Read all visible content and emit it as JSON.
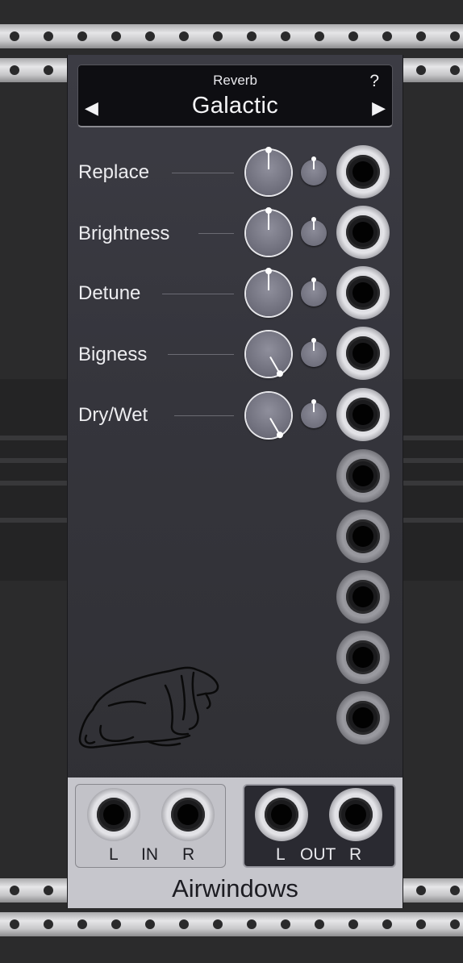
{
  "module": {
    "category": "Reverb",
    "preset_name": "Galactic",
    "help_label": "?",
    "prev_icon": "◀",
    "next_icon": "▶",
    "brand": "Airwindows"
  },
  "params": [
    {
      "label": "Replace",
      "knob_value_fraction": 0.5
    },
    {
      "label": "Brightness",
      "knob_value_fraction": 0.5
    },
    {
      "label": "Detune",
      "knob_value_fraction": 0.5
    },
    {
      "label": "Bigness",
      "knob_value_fraction": 1.0
    },
    {
      "label": "Dry/Wet",
      "knob_value_fraction": 1.0
    }
  ],
  "io": {
    "in_left": "L",
    "in_label": "IN",
    "in_right": "R",
    "out_left": "L",
    "out_label": "OUT",
    "out_right": "R"
  },
  "colors": {
    "panel": "#35353c",
    "display_bg": "#0e0e12",
    "footer": "#c6c6cc",
    "out_panel": "#2a2a31"
  },
  "icons": {
    "logo": "dog-logo-icon"
  }
}
